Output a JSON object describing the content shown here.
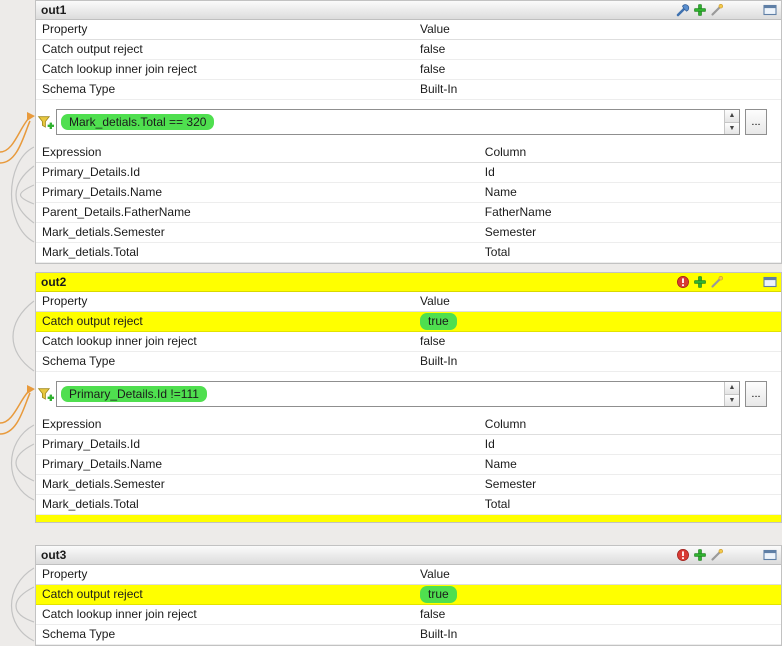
{
  "glyphs": {
    "spin_up": "▲",
    "spin_down": "▼",
    "ellipsis": "..."
  },
  "colors": {
    "highlight_yellow": "#ffff00",
    "highlight_green": "#4fdf4f",
    "connector_orange": "#e89a3c"
  },
  "panels": [
    {
      "title": "out1",
      "header_highlighted": false,
      "toolbar_icons": [
        "settings-wrench-icon",
        "add-plus-icon",
        "auto-map-wand-icon",
        "window-icon"
      ],
      "property_table": {
        "col1_header": "Property",
        "col2_header": "Value",
        "rows": [
          {
            "property": "Catch output reject",
            "value": "false",
            "row_highlighted": false,
            "value_highlighted": false
          },
          {
            "property": "Catch lookup inner join reject",
            "value": "false",
            "row_highlighted": false,
            "value_highlighted": false
          },
          {
            "property": "Schema Type",
            "value": "Built-In",
            "row_highlighted": false,
            "value_highlighted": false
          }
        ]
      },
      "filter": {
        "expression": "Mark_detials.Total == 320",
        "expression_highlighted": true
      },
      "expression_table": {
        "col1_header": "Expression",
        "col2_header": "Column",
        "rows": [
          {
            "expression": "Primary_Details.Id",
            "column": "Id"
          },
          {
            "expression": "Primary_Details.Name",
            "column": "Name"
          },
          {
            "expression": "Parent_Details.FatherName",
            "column": "FatherName"
          },
          {
            "expression": "Mark_detials.Semester",
            "column": "Semester"
          },
          {
            "expression": "Mark_detials.Total",
            "column": "Total"
          }
        ]
      }
    },
    {
      "title": "out2",
      "header_highlighted": true,
      "toolbar_icons": [
        "reject-filter-icon",
        "add-plus-icon",
        "auto-map-wand-icon",
        "window-icon"
      ],
      "property_table": {
        "col1_header": "Property",
        "col2_header": "Value",
        "rows": [
          {
            "property": "Catch output reject",
            "value": "true",
            "row_highlighted": true,
            "value_highlighted": true
          },
          {
            "property": "Catch lookup inner join reject",
            "value": "false",
            "row_highlighted": false,
            "value_highlighted": false
          },
          {
            "property": "Schema Type",
            "value": "Built-In",
            "row_highlighted": false,
            "value_highlighted": false
          }
        ]
      },
      "filter": {
        "expression": "Primary_Details.Id !=111",
        "expression_highlighted": true
      },
      "expression_table": {
        "col1_header": "Expression",
        "col2_header": "Column",
        "rows": [
          {
            "expression": "Primary_Details.Id",
            "column": "Id"
          },
          {
            "expression": "Primary_Details.Name",
            "column": "Name"
          },
          {
            "expression": "Mark_detials.Semester",
            "column": "Semester"
          },
          {
            "expression": "Mark_detials.Total",
            "column": "Total"
          }
        ]
      },
      "bottom_strip_highlighted": true
    },
    {
      "title": "out3",
      "header_highlighted": false,
      "toolbar_icons": [
        "reject-filter-icon",
        "add-plus-icon",
        "auto-map-wand-icon",
        "window-icon"
      ],
      "property_table": {
        "col1_header": "Property",
        "col2_header": "Value",
        "rows": [
          {
            "property": "Catch output reject",
            "value": "true",
            "row_highlighted": true,
            "value_highlighted": true
          },
          {
            "property": "Catch lookup inner join reject",
            "value": "false",
            "row_highlighted": false,
            "value_highlighted": false
          },
          {
            "property": "Schema Type",
            "value": "Built-In",
            "row_highlighted": false,
            "value_highlighted": false
          }
        ]
      }
    }
  ]
}
